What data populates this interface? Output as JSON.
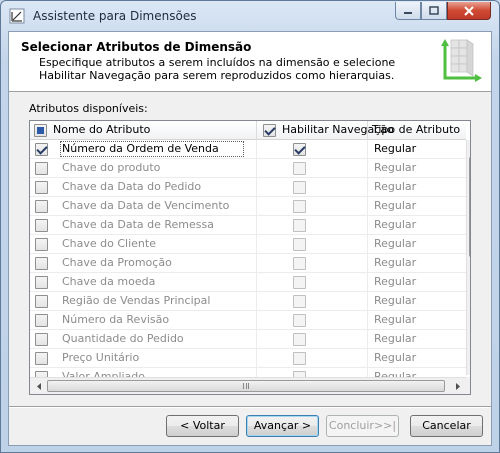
{
  "window": {
    "title": "Assistente para Dimensões"
  },
  "header": {
    "title": "Selecionar Atributos de Dimensão",
    "description": "Especifique atributos a serem incluídos na dimensão e selecione Habilitar Navegação para serem reproduzidos como hierarquias."
  },
  "grid": {
    "label": "Atributos disponíveis:",
    "columns": {
      "name": "Nome do Atributo",
      "browse": "Habilitar Navegação",
      "type": "Tipo de Atributo"
    },
    "rows": [
      {
        "name": "Número da Ordem de Venda",
        "type": "Regular",
        "included": true,
        "browse": true
      },
      {
        "name": "Chave do produto",
        "type": "Regular",
        "included": false,
        "browse": false
      },
      {
        "name": "Chave da Data do Pedido",
        "type": "Regular",
        "included": false,
        "browse": false
      },
      {
        "name": "Chave da Data de Vencimento",
        "type": "Regular",
        "included": false,
        "browse": false
      },
      {
        "name": "Chave da Data de Remessa",
        "type": "Regular",
        "included": false,
        "browse": false
      },
      {
        "name": "Chave do Cliente",
        "type": "Regular",
        "included": false,
        "browse": false
      },
      {
        "name": "Chave da Promoção",
        "type": "Regular",
        "included": false,
        "browse": false
      },
      {
        "name": "Chave da moeda",
        "type": "Regular",
        "included": false,
        "browse": false
      },
      {
        "name": "Região de Vendas Principal",
        "type": "Regular",
        "included": false,
        "browse": false
      },
      {
        "name": "Número da Revisão",
        "type": "Regular",
        "included": false,
        "browse": false
      },
      {
        "name": "Quantidade do Pedido",
        "type": "Regular",
        "included": false,
        "browse": false
      },
      {
        "name": "Preço Unitário",
        "type": "Regular",
        "included": false,
        "browse": false
      },
      {
        "name": "Valor Ampliado",
        "type": "Regular",
        "included": false,
        "browse": false
      }
    ]
  },
  "buttons": {
    "back": "< Voltar",
    "next": "Avançar >",
    "finish": "Concluir>>|",
    "cancel": "Cancelar"
  },
  "colors": {
    "accent_green": "#4fbf3f",
    "close_red": "#c0392b",
    "disabled_text": "#8c8c8c"
  }
}
